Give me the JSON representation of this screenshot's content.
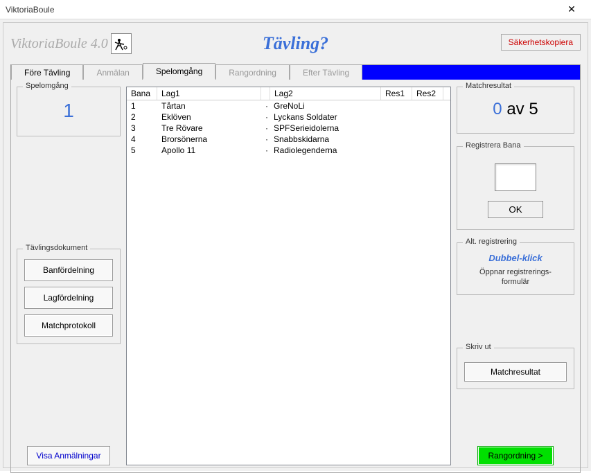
{
  "window": {
    "title": "ViktoriaBoule",
    "app_title": "ViktoriaBoule 4.0",
    "page_title": "Tävling?",
    "backup_label": "Säkerhetskopiera"
  },
  "tabs": [
    {
      "label": "Före Tävling",
      "enabled": true,
      "active": false
    },
    {
      "label": "Anmälan",
      "enabled": false,
      "active": false
    },
    {
      "label": "Spelomgång",
      "enabled": true,
      "active": true
    },
    {
      "label": "Rangordning",
      "enabled": false,
      "active": false
    },
    {
      "label": "Efter Tävling",
      "enabled": false,
      "active": false
    }
  ],
  "left": {
    "round_label": "Spelomgång",
    "round_num": "1",
    "docs_label": "Tävlingsdokument",
    "btn_ban": "Banfördelning",
    "btn_lag": "Lagfördelning",
    "btn_match": "Matchprotokoll",
    "btn_anmal": "Visa Anmälningar"
  },
  "list": {
    "headers": {
      "bana": "Bana",
      "lag1": "Lag1",
      "lag2": "Lag2",
      "res1": "Res1",
      "res2": "Res2"
    },
    "rows": [
      {
        "bana": "1",
        "lag1": "Tårtan",
        "sep": "·",
        "lag2": "GreNoLi",
        "res1": "",
        "res2": ""
      },
      {
        "bana": "2",
        "lag1": "Eklöven",
        "sep": "·",
        "lag2": "Lyckans Soldater",
        "res1": "",
        "res2": ""
      },
      {
        "bana": "3",
        "lag1": "Tre Rövare",
        "sep": "·",
        "lag2": "SPFSerieidolerna",
        "res1": "",
        "res2": ""
      },
      {
        "bana": "4",
        "lag1": "Brorsönerna",
        "sep": "·",
        "lag2": "Snabbskidarna",
        "res1": "",
        "res2": ""
      },
      {
        "bana": "5",
        "lag1": "Apollo 11",
        "sep": "·",
        "lag2": "Radiolegenderna",
        "res1": "",
        "res2": ""
      }
    ]
  },
  "right": {
    "match_label": "Matchresultat",
    "match_count": "0",
    "match_sep": "av",
    "match_total": "5",
    "reg_label": "Registrera Bana",
    "reg_value": "",
    "btn_ok": "OK",
    "alt_label": "Alt. registrering",
    "alt_text": "Dubbel-klick",
    "alt_sub": "Öppnar registrerings-\nformulär",
    "print_label": "Skriv ut",
    "btn_print": "Matchresultat",
    "btn_next": "Rangordning >"
  }
}
